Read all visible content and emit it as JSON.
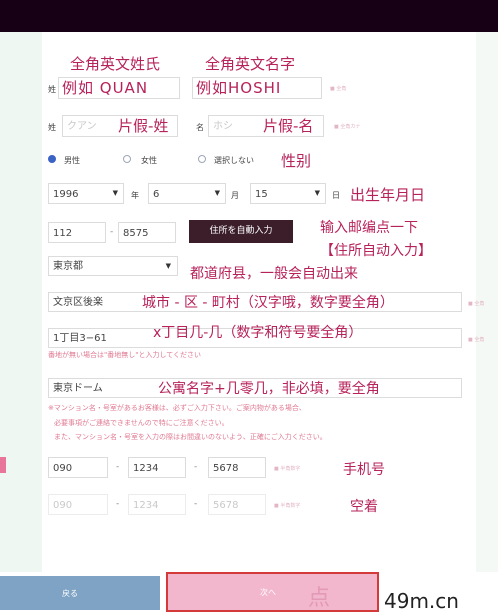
{
  "annotations": {
    "surname_fw": "全角英文姓氏",
    "given_fw": "全角英文名字",
    "example_surname": "例如 QUAN",
    "example_given": "例如HOSHI",
    "kana_surname": "片假-姓",
    "kana_given": "片假-名",
    "gender": "性别",
    "birthdate": "出生年月日",
    "postal_line1": "输入邮编点一下",
    "postal_line2": "【住所自动入力】",
    "prefecture": "都道府县，一般会自动出来",
    "city": "城市 - 区 - 町村（汉字哦，数字要全角）",
    "chome": "x丁目几-几（数字和符号要全角）",
    "building": "公寓名字+几零几，非必填，要全角",
    "phone": "手机号",
    "leave_empty": "空着",
    "click": "点"
  },
  "form": {
    "sei_label": "姓",
    "mei_label": "名",
    "sei_kana_value": "クアン",
    "mei_kana_value": "ホシ",
    "required_marks": {
      "name": "■ 全角",
      "kana": "■ 全角カナ",
      "city": "■ 全角",
      "chome": "■ 全角",
      "phone": "■ 半角数字",
      "phone2": "■ 半角数字"
    },
    "gender_options": [
      "男性",
      "女性",
      "選択しない"
    ],
    "year_value": "1996",
    "year_label": "年",
    "month_value": "6",
    "month_label": "月",
    "day_value": "15",
    "day_label": "日",
    "zip1": "112",
    "zip2": "8575",
    "auto_address_button": "住所を自動入力",
    "prefecture_value": "東京都",
    "city_value": "文京区後楽",
    "chome_value": "1丁目3−61",
    "chome_note": "番地が無い場合は\"番地無し\"と入力してください",
    "building_value": "東京ドーム",
    "building_notes": [
      "※マンション名・号室があるお客様は、必ずご入力下さい。ご案内物がある場合、",
      "必要事項がご連絡できませんので特にご注意ください。",
      "また、マンション名・号室を入力の際はお間違いのないよう、正確にご入力ください。"
    ],
    "phone1": "090",
    "phone2": "1234",
    "phone3": "5678",
    "phone_b1": "090",
    "phone_b2": "1234",
    "phone_b3": "5678",
    "back_button": "戻る",
    "next_button": "次へ"
  },
  "watermark": "49m.cn",
  "colors": {
    "annotation": "#b7225a",
    "top_bar": "#170016",
    "auto_button": "#3b1e2a",
    "back_button": "#7ea3c4",
    "next_button": "#f2b7cc",
    "radio_selected": "#3b63c6"
  }
}
